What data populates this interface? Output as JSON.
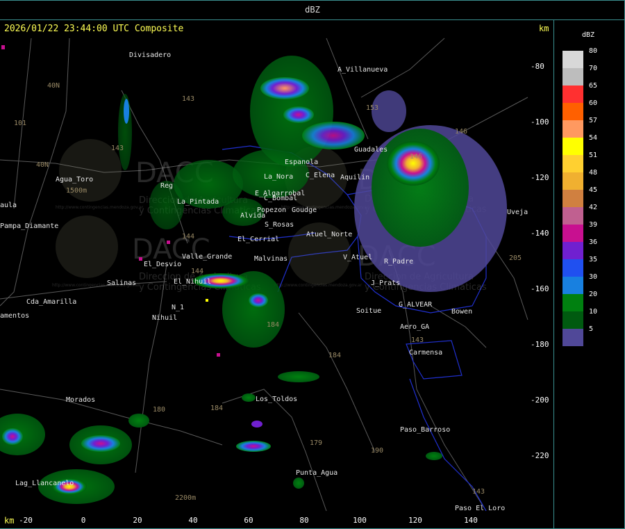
{
  "header": {
    "title": "dBZ"
  },
  "map_title": "2026/01/22 23:44:00 UTC Composite",
  "axis": {
    "unit": "km",
    "y_ticks": [
      "-80",
      "-100",
      "-120",
      "-140",
      "-160",
      "-180",
      "-200",
      "-220"
    ],
    "x_ticks": [
      "-20",
      "0",
      "20",
      "40",
      "60",
      "80",
      "100",
      "120",
      "140"
    ]
  },
  "legend": {
    "unit": "dBZ",
    "levels": [
      {
        "value": "80",
        "color": "#d8d8d8"
      },
      {
        "value": "70",
        "color": "#bdbdbd"
      },
      {
        "value": "65",
        "color": "#ff3030"
      },
      {
        "value": "60",
        "color": "#ff6000"
      },
      {
        "value": "57",
        "color": "#ff9960"
      },
      {
        "value": "54",
        "color": "#ffff00"
      },
      {
        "value": "51",
        "color": "#ffd030"
      },
      {
        "value": "48",
        "color": "#f0b030"
      },
      {
        "value": "45",
        "color": "#d08040"
      },
      {
        "value": "42",
        "color": "#c06090"
      },
      {
        "value": "39",
        "color": "#c81090"
      },
      {
        "value": "36",
        "color": "#7020d0"
      },
      {
        "value": "35",
        "color": "#2050f0"
      },
      {
        "value": "30",
        "color": "#1880e0"
      },
      {
        "value": "20",
        "color": "#008010"
      },
      {
        "value": "10",
        "color": "#005a10"
      },
      {
        "value": "5",
        "color": "#504898"
      }
    ]
  },
  "places": [
    "Divisadero",
    "A_Villanueva",
    "Agua_Toro",
    "Pampa_Diamante",
    "Reg",
    "La_Pintada",
    "El_Nihuil",
    "Valle_Grande",
    "El_Desvio",
    "Salinas",
    "Cda_Amarilla",
    "Nihuil",
    "N_1",
    "Morados",
    "Los_Toldos",
    "Lag_Llancanelo",
    "Punta_Agua",
    "Paso_Barroso",
    "Paso_El_Loro",
    "Carmensa",
    "Soitue",
    "G_ALVEAR",
    "Aero_GA",
    "Bowen",
    "V_Atuel",
    "R_Padre",
    "J_Prats",
    "Atuel_Norte",
    "S_Rosas",
    "C_Bombal",
    "E_Algarrobal",
    "Goudge",
    "Popezon",
    "La_Nora",
    "Espanola",
    "C_Elena",
    "Aquilin",
    "Uveja",
    "Guadales",
    "El_Cerrial",
    "Malvinas",
    "Alvida",
    "amentos",
    "aula"
  ],
  "routes": [
    "40N",
    "40N",
    "101",
    "143",
    "143",
    "146",
    "146",
    "144",
    "144",
    "184",
    "184",
    "180",
    "179",
    "190",
    "143",
    "143",
    "205",
    "184",
    "153"
  ],
  "elevations": [
    "1500m",
    "2200m"
  ],
  "watermark": {
    "logo": "DACC",
    "line1": "Direccion de Agricultura",
    "line2": "y Contingencias Climaticas",
    "url": "http://www.contingencias.mendoza.gov.ar"
  }
}
